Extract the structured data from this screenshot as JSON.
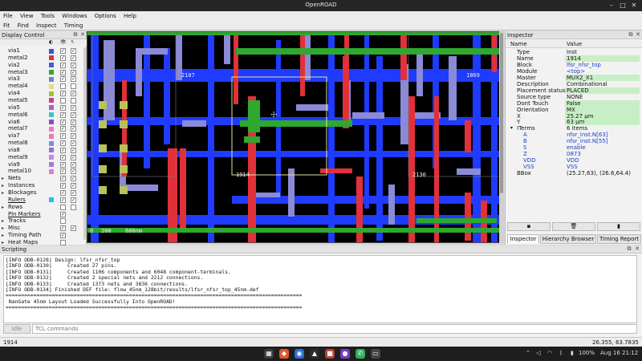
{
  "window": {
    "title": "OpenROAD"
  },
  "menu": {
    "main": [
      "File",
      "View",
      "Tools",
      "Windows",
      "Options",
      "Help"
    ],
    "toolbar": [
      "Fit",
      "Find",
      "Inspect",
      "Timing"
    ]
  },
  "display_control": {
    "title": "Display Control",
    "layers": [
      {
        "label": "via1",
        "color": "#3b52e6",
        "v": true,
        "s": true
      },
      {
        "label": "metal2",
        "color": "#e0313a",
        "v": true,
        "s": true
      },
      {
        "label": "via2",
        "color": "#4d5ad0",
        "v": true,
        "s": true
      },
      {
        "label": "metal3",
        "color": "#2ea82e",
        "v": true,
        "s": true
      },
      {
        "label": "via3",
        "color": "#7a7ad6",
        "v": true,
        "s": true
      },
      {
        "label": "metal4",
        "color": "#dfe07a",
        "v": false,
        "s": false
      },
      {
        "label": "via4",
        "color": "#9ac23a",
        "v": true,
        "s": true
      },
      {
        "label": "metal5",
        "color": "#d23a8a",
        "v": false,
        "s": false
      },
      {
        "label": "via5",
        "color": "#b25ad6",
        "v": true,
        "s": true
      },
      {
        "label": "metal6",
        "color": "#33c9c9",
        "v": true,
        "s": true
      },
      {
        "label": "via6",
        "color": "#8a4ac6",
        "v": true,
        "s": true
      },
      {
        "label": "metal7",
        "color": "#f07ac2",
        "v": true,
        "s": true
      },
      {
        "label": "via7",
        "color": "#e67ab8",
        "v": true,
        "s": true
      },
      {
        "label": "metal8",
        "color": "#7a8ae6",
        "v": true,
        "s": true
      },
      {
        "label": "via8",
        "color": "#9a6ed6",
        "v": true,
        "s": true
      },
      {
        "label": "metal9",
        "color": "#c28ae6",
        "v": true,
        "s": true
      },
      {
        "label": "via9",
        "color": "#a27ae0",
        "v": true,
        "s": true
      },
      {
        "label": "metal10",
        "color": "#e07ad6",
        "v": true,
        "s": true
      }
    ],
    "groups": [
      {
        "label": "Nets",
        "arrow": "▸",
        "color": "",
        "v": true,
        "s": true,
        "under": false
      },
      {
        "label": "Instances",
        "arrow": "▸",
        "color": "",
        "v": true,
        "s": true,
        "under": false
      },
      {
        "label": "Blockages",
        "arrow": "▸",
        "color": "",
        "v": true,
        "s": true,
        "under": false
      },
      {
        "label": "Rulers",
        "arrow": "",
        "color": "#22c0e6",
        "v": true,
        "s": true,
        "under": true
      },
      {
        "label": "Rows",
        "arrow": "▸",
        "color": "",
        "v": false,
        "s": false,
        "under": false
      },
      {
        "label": "Pin Markers",
        "arrow": "",
        "color": "",
        "v": true,
        "s": null,
        "under": true
      },
      {
        "label": "Tracks",
        "arrow": "▸",
        "color": "",
        "v": false,
        "s": null,
        "under": false
      },
      {
        "label": "Misc",
        "arrow": "▸",
        "color": "",
        "v": true,
        "s": true,
        "under": false
      },
      {
        "label": "Timing Path",
        "arrow": "▸",
        "color": "",
        "v": true,
        "s": null,
        "under": false
      },
      {
        "label": "Heat Maps",
        "arrow": "▸",
        "color": "",
        "v": false,
        "s": null,
        "under": false
      }
    ]
  },
  "layout": {
    "labels": [
      {
        "text": "2107"
      },
      {
        "text": "1869"
      },
      {
        "text": "1914"
      },
      {
        "text": "2130"
      }
    ],
    "ruler": [
      "0",
      "200",
      "600nm"
    ]
  },
  "inspector": {
    "title": "Inspector",
    "headers": [
      "Name",
      "Value"
    ],
    "rows": [
      {
        "k": "Type",
        "v": "Inst",
        "style": "plain"
      },
      {
        "k": "Name",
        "v": "1914",
        "style": "edit"
      },
      {
        "k": "Block",
        "v": "lfsr_nfsr_top",
        "style": "link"
      },
      {
        "k": "Module",
        "v": "<top>",
        "style": "link"
      },
      {
        "k": "Master",
        "v": "MUX2_X1",
        "style": "edit"
      },
      {
        "k": "Description",
        "v": "Combinational",
        "style": "plain"
      },
      {
        "k": "Placement status",
        "v": "PLACED",
        "style": "edit"
      },
      {
        "k": "Source type",
        "v": "NONE",
        "style": "plain"
      },
      {
        "k": "Dont Touch",
        "v": "False",
        "style": "edit"
      },
      {
        "k": "Orientation",
        "v": "MX",
        "style": "edit"
      },
      {
        "k": "X",
        "v": "25.27 μm",
        "style": "edit"
      },
      {
        "k": "Y",
        "v": "63 μm",
        "style": "edit"
      },
      {
        "k": "ITerms",
        "v": "6 items",
        "style": "plain",
        "expander": "▾"
      },
      {
        "k": "A",
        "v": "nfsr_inst.N[63]",
        "style": "link",
        "indent": true
      },
      {
        "k": "B",
        "v": "nfsr_inst.N[55]",
        "style": "link",
        "indent": true
      },
      {
        "k": "S",
        "v": "enable",
        "style": "link",
        "indent": true
      },
      {
        "k": "Z",
        "v": "0873",
        "style": "link",
        "indent": true
      },
      {
        "k": "VDD",
        "v": "VDD",
        "style": "link",
        "indent": true
      },
      {
        "k": "VSS",
        "v": "VSS",
        "style": "link",
        "indent": true
      },
      {
        "k": "BBox",
        "v": "(25.27,63), (26.6,64.4)",
        "style": "plain"
      }
    ],
    "buttons": [
      "▪",
      "🗑",
      "▮"
    ],
    "tabs": [
      "Inspector",
      "Hierarchy Browser",
      "Timing Report"
    ]
  },
  "scripting": {
    "title": "Scripting",
    "log": [
      "[INFO ODB-0128] Design: lfsr_nfsr_top",
      "[INFO ODB-0130]     Created 27 pins.",
      "[INFO ODB-0131]     Created 1106 components and 6048 component-terminals.",
      "[INFO ODB-0132]     Created 2 special nets and 2212 connections.",
      "[INFO ODB-0133]     Created 1373 nets and 3836 connections.",
      "[INFO ODB-0134] Finished DEF file: flow_45nm_128bit/results/lfsr_nfsr_top_45nm.def",
      "================================================================================================",
      " NanGate 45nm Layout Loaded Successfully Into OpenROAD!",
      "================================================================================================"
    ],
    "idle_label": "Idle",
    "tcl_placeholder": "TCL commands"
  },
  "status": {
    "left": "1914",
    "right": "26.355, 63.7835"
  },
  "taskbar": {
    "battery": "100%",
    "datetime": "Aug 16  21:12"
  },
  "colors": {
    "metal1": "#1f3bff",
    "metal2": "#e0313a",
    "metal3": "#2ea82e",
    "via": "#8a8ad6",
    "highlight": "#e8e2a0"
  }
}
